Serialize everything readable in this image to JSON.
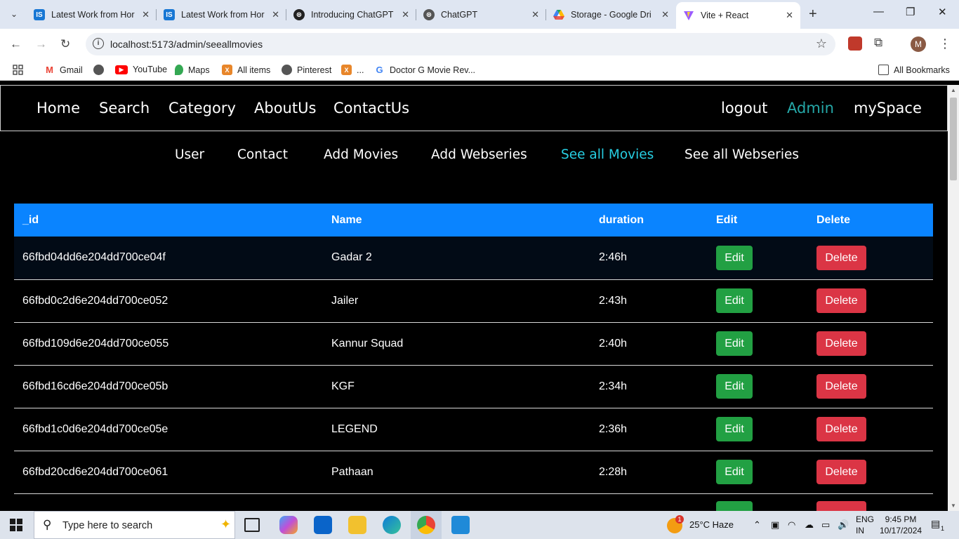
{
  "browser": {
    "tabs": [
      {
        "title": "Latest Work from Hor",
        "favicon": "is-icon",
        "color": "#1877d4"
      },
      {
        "title": "Latest Work from Hor",
        "favicon": "is-icon",
        "color": "#1877d4"
      },
      {
        "title": "Introducing ChatGPT",
        "favicon": "openai-icon",
        "color": "#222222"
      },
      {
        "title": "ChatGPT",
        "favicon": "openai-icon",
        "color": "#444444"
      },
      {
        "title": "Storage - Google Dri",
        "favicon": "google-drive-icon",
        "color": "#1fa463"
      },
      {
        "title": "Vite + React",
        "favicon": "vite-icon",
        "color": "#9b5cff"
      }
    ],
    "url": "localhost:5173/admin/seeallmovies",
    "profile_initial": "M",
    "bookmarks": [
      "Gmail",
      "YouTube",
      "Maps",
      "All items",
      "Pinterest",
      "...",
      "Doctor G Movie Rev...",
      "All Bookmarks"
    ]
  },
  "nav": {
    "home": "Home",
    "search": "Search",
    "category": "Category",
    "about": "AboutUs",
    "contact": "ContactUs",
    "logout": "logout",
    "admin": "Admin",
    "myspace": "mySpace"
  },
  "subnav": {
    "user": "User",
    "contact": "Contact",
    "add_movies": "Add Movies",
    "add_webseries": "Add Webseries",
    "see_all_movies": "See all Movies",
    "see_all_webseries": "See all Webseries"
  },
  "table": {
    "headers": [
      "_id",
      "Name",
      "duration",
      "Edit",
      "Delete"
    ],
    "rows": [
      {
        "id": "66fbd04dd6e204dd700ce04f",
        "name": "Gadar 2",
        "duration": "2:46h",
        "edit": "Edit",
        "delete": "Delete"
      },
      {
        "id": "66fbd0c2d6e204dd700ce052",
        "name": "Jailer",
        "duration": "2:43h",
        "edit": "Edit",
        "delete": "Delete"
      },
      {
        "id": "66fbd109d6e204dd700ce055",
        "name": "Kannur Squad",
        "duration": "2:40h",
        "edit": "Edit",
        "delete": "Delete"
      },
      {
        "id": "66fbd16cd6e204dd700ce05b",
        "name": "KGF",
        "duration": "2:34h",
        "edit": "Edit",
        "delete": "Delete"
      },
      {
        "id": "66fbd1c0d6e204dd700ce05e",
        "name": "LEGEND",
        "duration": "2:36h",
        "edit": "Edit",
        "delete": "Delete"
      },
      {
        "id": "66fbd20cd6e204dd700ce061",
        "name": "Pathaan",
        "duration": "2:28h",
        "edit": "Edit",
        "delete": "Delete"
      }
    ]
  },
  "taskbar": {
    "search_placeholder": "Type here to search",
    "weather": "25°C  Haze",
    "weather_badge": "1",
    "lang_top": "ENG",
    "lang_bottom": "IN",
    "time": "9:45 PM",
    "date": "10/17/2024",
    "notif_count": "1"
  },
  "colors": {
    "header_blue": "#0a84ff",
    "edit_green": "#22a043",
    "delete_red": "#db3545",
    "active_cyan": "#27cfe3",
    "admin_teal": "#25a8a8"
  }
}
